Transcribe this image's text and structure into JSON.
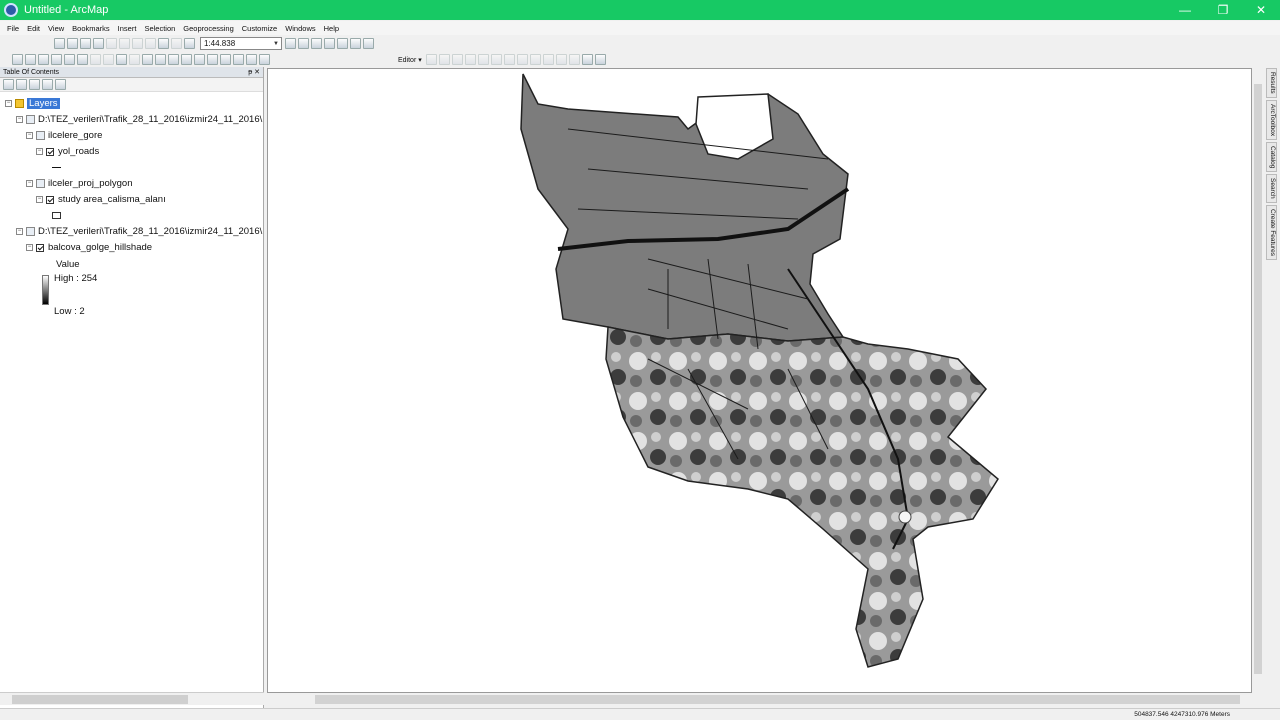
{
  "window": {
    "title": "Untitled - ArcMap",
    "minimize": "—",
    "maximize": "❐",
    "close": "✕"
  },
  "menu": [
    "File",
    "Edit",
    "View",
    "Bookmarks",
    "Insert",
    "Selection",
    "Geoprocessing",
    "Customize",
    "Windows",
    "Help"
  ],
  "toolbar": {
    "scale": "1:44.838",
    "editor_label": "Editor ▾"
  },
  "toc": {
    "title": "Table Of Contents",
    "pin": "ᵽ ✕",
    "layers_label": "Layers",
    "group1_path": "D:\\TEZ_verileri\\Trafik_28_11_2016\\izmir24_11_2016\\",
    "layer_ilcelere": "ilcelere_gore",
    "layer_roads": "yol_roads",
    "layer_ilceler_proj": "ilceler_proj_polygon",
    "layer_study": "study area_calisma_alanı",
    "group2_path": "D:\\TEZ_verileri\\Trafik_28_11_2016\\izmir24_11_2016\\",
    "layer_hillshade": "balcova_golge_hillshade",
    "legend_value": "Value",
    "legend_high": "High : 254",
    "legend_low": "Low : 2"
  },
  "side_tabs": [
    "Results",
    "ArcToolbox",
    "Catalog",
    "Search",
    "Create Features"
  ],
  "status": {
    "coords": "504837.546  4247310.976 Meters"
  },
  "colors": {
    "titlebar": "#17c964",
    "selection": "#3a78d6"
  }
}
